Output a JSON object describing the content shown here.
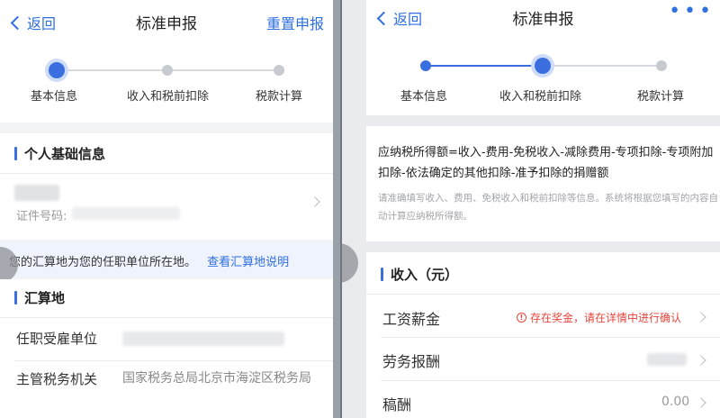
{
  "left": {
    "nav": {
      "back": "返回",
      "title": "标准申报",
      "action": "重置申报"
    },
    "steps": [
      {
        "label": "基本信息",
        "state": "active"
      },
      {
        "label": "收入和税前扣除",
        "state": "todo"
      },
      {
        "label": "税款计算",
        "state": "todo"
      }
    ],
    "personal": {
      "title": "个人基础信息",
      "id_label": "证件号码:"
    },
    "notice": {
      "text": "您的汇算地为您的任职单位所在地。",
      "link": "查看汇算地说明"
    },
    "region": {
      "title": "汇算地",
      "employer_label": "任职受雇单位",
      "tax_office_label": "主管税务机关",
      "tax_office_value": "国家税务总局北京市海淀区税务局"
    }
  },
  "right": {
    "nav": {
      "back": "返回",
      "title": "标准申报",
      "more": "•••"
    },
    "steps": [
      {
        "label": "基本信息",
        "state": "done"
      },
      {
        "label": "收入和税前扣除",
        "state": "active"
      },
      {
        "label": "税款计算",
        "state": "todo"
      }
    ],
    "formula": "应纳税所得额=收入-费用-免税收入-减除费用-专项扣除-专项附加扣除-依法确定的其他扣除-准予扣除的捐赠额",
    "hint": "请准确填写收入、费用、免税收入和税前扣除等信息。系统将根据您填写的内容自动计算应纳税所得额。",
    "income": {
      "title": "收入（元）",
      "rows": [
        {
          "label": "工资薪金",
          "warning": "存在奖金，请在详情中进行确认"
        },
        {
          "label": "劳务报酬"
        },
        {
          "label": "稿酬",
          "value": "0.00"
        }
      ]
    }
  },
  "colors": {
    "accent": "#3b6fe0",
    "warning": "#e5453b",
    "link": "#2f6fe0"
  },
  "icons": {
    "warning": "exclamation-circle-icon",
    "back": "chevron-left-icon",
    "row": "chevron-right-icon"
  }
}
